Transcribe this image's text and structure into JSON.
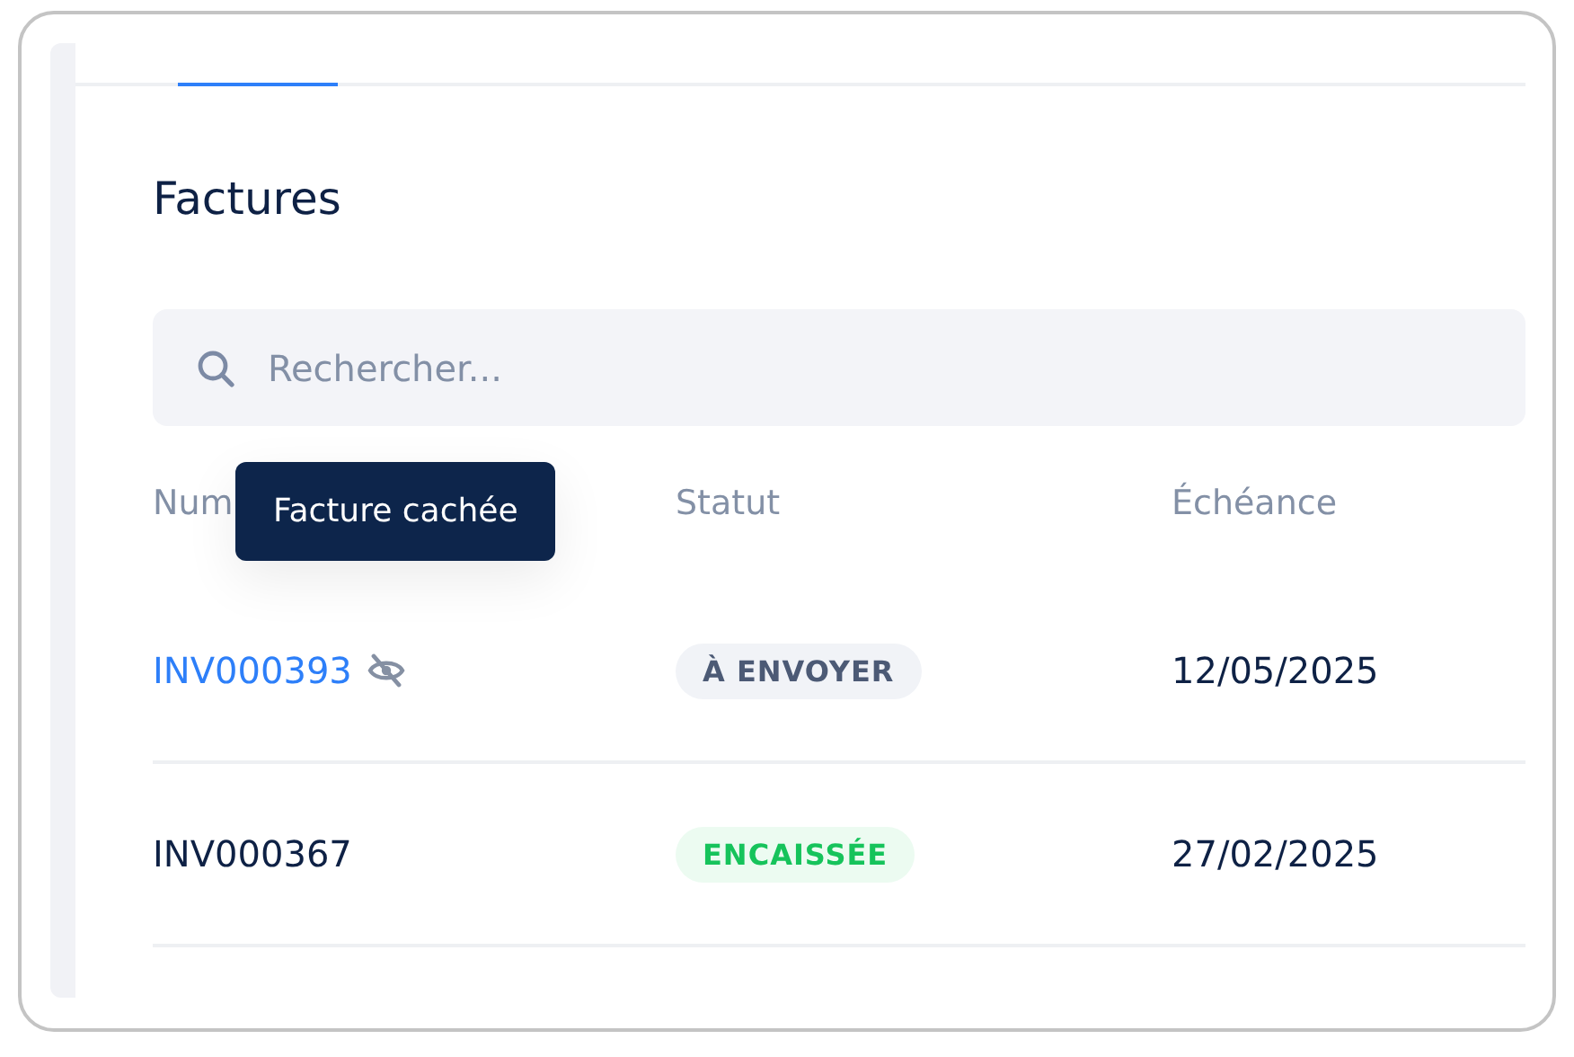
{
  "title": "Factures",
  "search": {
    "placeholder": "Rechercher..."
  },
  "columns": [
    "Num",
    "Statut",
    "Échéance"
  ],
  "tooltip": "Facture cachée",
  "rows": [
    {
      "number": "INV000393",
      "hidden": true,
      "status": {
        "label": "À ENVOYER",
        "kind": "to_send"
      },
      "due": "12/05/2025"
    },
    {
      "number": "INV000367",
      "hidden": false,
      "status": {
        "label": "ENCAISSÉE",
        "kind": "cashed"
      },
      "due": "27/02/2025"
    }
  ]
}
